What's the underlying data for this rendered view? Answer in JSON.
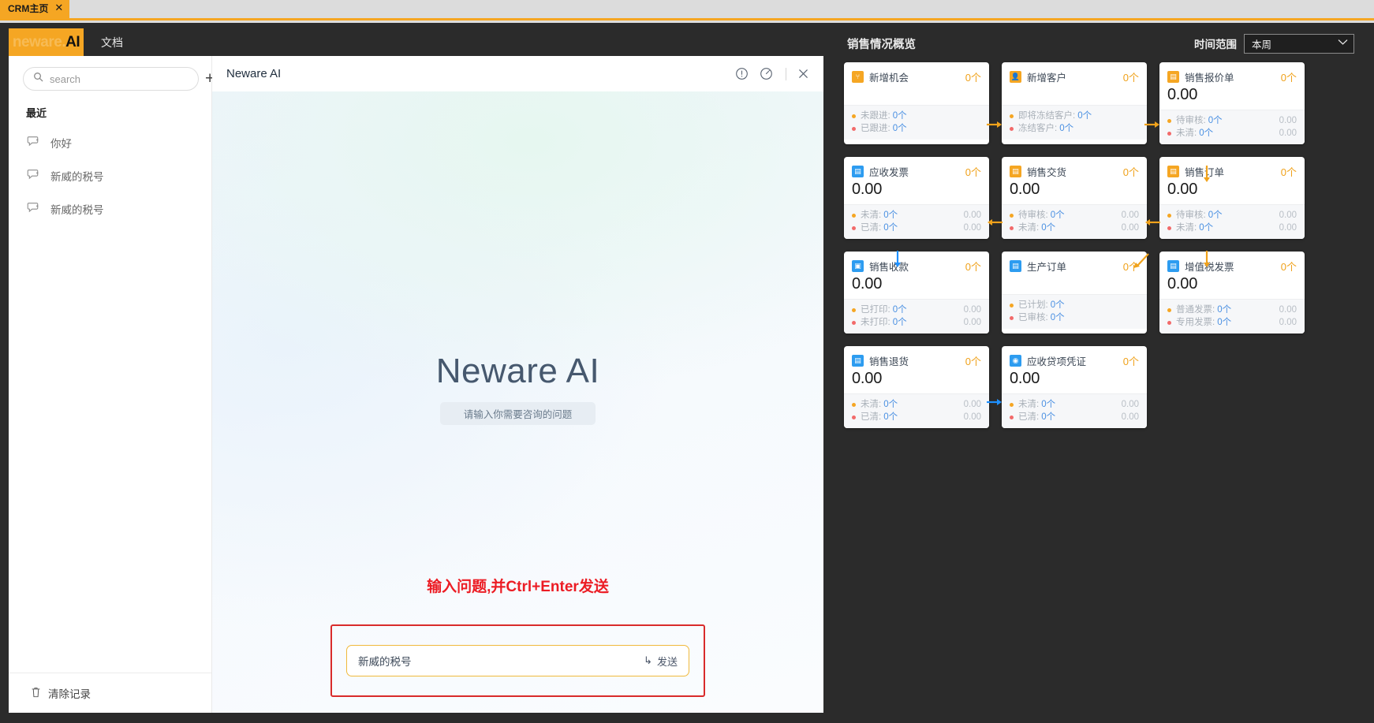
{
  "browser": {
    "tab_title": "CRM主页",
    "tab_close": "✕"
  },
  "ai_app": {
    "logo_dim": "neware.",
    "logo_bold": "AI",
    "tab_doc": "文档",
    "search_placeholder": "search",
    "add_button": "+",
    "recent_label": "最近",
    "chats": [
      {
        "title": "你好"
      },
      {
        "title": "新威的税号"
      },
      {
        "title": "新威的税号"
      }
    ],
    "clear_records": "清除记录",
    "chat_title": "Neware AI",
    "hero_title": "Neware AI",
    "hero_subtitle": "请输入你需要咨询的问题",
    "hint": "输入问题,并Ctrl+Enter发送",
    "compose_value": "新威的税号",
    "compose_placeholder": "",
    "send_label": "发送",
    "send_glyph": "↳"
  },
  "dashboard": {
    "title": "销售情况概览",
    "range_label": "时间范围",
    "range_value": "本周",
    "rows": [
      [
        {
          "id": "new-opportunity",
          "icon": "opportunity-icon",
          "icon_color": "amber",
          "icon_glyph": "⑂",
          "name": "新增机会",
          "count": "0个",
          "amount": null,
          "details": [
            {
              "dot": "amber",
              "label": "未跟进:",
              "value": "0个",
              "right": null
            },
            {
              "dot": "red",
              "label": "已跟进:",
              "value": "0个",
              "right": null
            }
          ]
        },
        {
          "id": "new-customer",
          "icon": "customer-icon",
          "icon_color": "amber",
          "icon_glyph": "👤",
          "name": "新增客户",
          "count": "0个",
          "amount": null,
          "details": [
            {
              "dot": "amber",
              "label": "即将冻结客户:",
              "value": "0个",
              "right": null
            },
            {
              "dot": "red",
              "label": "冻结客户:",
              "value": "0个",
              "right": null
            }
          ]
        },
        {
          "id": "sales-quotation",
          "icon": "quotation-icon",
          "icon_color": "amber",
          "icon_glyph": "▤",
          "name": "销售报价单",
          "count": "0个",
          "amount": "0.00",
          "details": [
            {
              "dot": "amber",
              "label": "待审核:",
              "value": "0个",
              "right": "0.00"
            },
            {
              "dot": "red",
              "label": "未清:",
              "value": "0个",
              "right": "0.00"
            }
          ]
        }
      ],
      [
        {
          "id": "receivable-invoice",
          "icon": "invoice-icon",
          "icon_color": "blue",
          "icon_glyph": "▤",
          "name": "应收发票",
          "count": "0个",
          "amount": "0.00",
          "details": [
            {
              "dot": "amber",
              "label": "未清:",
              "value": "0个",
              "right": "0.00"
            },
            {
              "dot": "red",
              "label": "已清:",
              "value": "0个",
              "right": "0.00"
            }
          ]
        },
        {
          "id": "sales-delivery",
          "icon": "delivery-icon",
          "icon_color": "amber",
          "icon_glyph": "▤",
          "name": "销售交货",
          "count": "0个",
          "amount": "0.00",
          "details": [
            {
              "dot": "amber",
              "label": "待审核:",
              "value": "0个",
              "right": "0.00"
            },
            {
              "dot": "red",
              "label": "未清:",
              "value": "0个",
              "right": "0.00"
            }
          ]
        },
        {
          "id": "sales-order",
          "icon": "order-icon",
          "icon_color": "amber",
          "icon_glyph": "▤",
          "name": "销售订单",
          "count": "0个",
          "amount": "0.00",
          "details": [
            {
              "dot": "amber",
              "label": "待审核:",
              "value": "0个",
              "right": "0.00"
            },
            {
              "dot": "red",
              "label": "未清:",
              "value": "0个",
              "right": "0.00"
            }
          ]
        }
      ],
      [
        {
          "id": "sales-receipt",
          "icon": "receipt-icon",
          "icon_color": "blue",
          "icon_glyph": "▣",
          "name": "销售收款",
          "count": "0个",
          "amount": "0.00",
          "details": [
            {
              "dot": "amber",
              "label": "已打印:",
              "value": "0个",
              "right": "0.00"
            },
            {
              "dot": "red",
              "label": "未打印:",
              "value": "0个",
              "right": "0.00"
            }
          ]
        },
        {
          "id": "production-order",
          "icon": "production-icon",
          "icon_color": "blue",
          "icon_glyph": "▤",
          "name": "生产订单",
          "count": "0个",
          "amount": null,
          "details": [
            {
              "dot": "amber",
              "label": "已计划:",
              "value": "0个",
              "right": null
            },
            {
              "dot": "red",
              "label": "已审核:",
              "value": "0个",
              "right": null
            }
          ]
        },
        {
          "id": "vat-invoice",
          "icon": "vat-invoice-icon",
          "icon_color": "blue",
          "icon_glyph": "▤",
          "name": "增值税发票",
          "count": "0个",
          "amount": "0.00",
          "details": [
            {
              "dot": "amber",
              "label": "普通发票:",
              "value": "0个",
              "right": "0.00"
            },
            {
              "dot": "red",
              "label": "专用发票:",
              "value": "0个",
              "right": "0.00"
            }
          ]
        }
      ],
      [
        {
          "id": "sales-return",
          "icon": "return-icon",
          "icon_color": "blue",
          "icon_glyph": "▤",
          "name": "销售退货",
          "count": "0个",
          "amount": "0.00",
          "details": [
            {
              "dot": "amber",
              "label": "未清:",
              "value": "0个",
              "right": "0.00"
            },
            {
              "dot": "red",
              "label": "已清:",
              "value": "0个",
              "right": "0.00"
            }
          ]
        },
        {
          "id": "credit-note",
          "icon": "credit-note-icon",
          "icon_color": "blue",
          "icon_glyph": "◉",
          "name": "应收贷项凭证",
          "count": "0个",
          "amount": "0.00",
          "details": [
            {
              "dot": "amber",
              "label": "未清:",
              "value": "0个",
              "right": "0.00"
            },
            {
              "dot": "red",
              "label": "已清:",
              "value": "0个",
              "right": "0.00"
            }
          ]
        }
      ]
    ],
    "colors": {
      "accent_amber": "#f5a623",
      "accent_blue": "#2d9cf0",
      "flow_amber": "#f0a21b",
      "flow_blue": "#1e90ff"
    }
  }
}
